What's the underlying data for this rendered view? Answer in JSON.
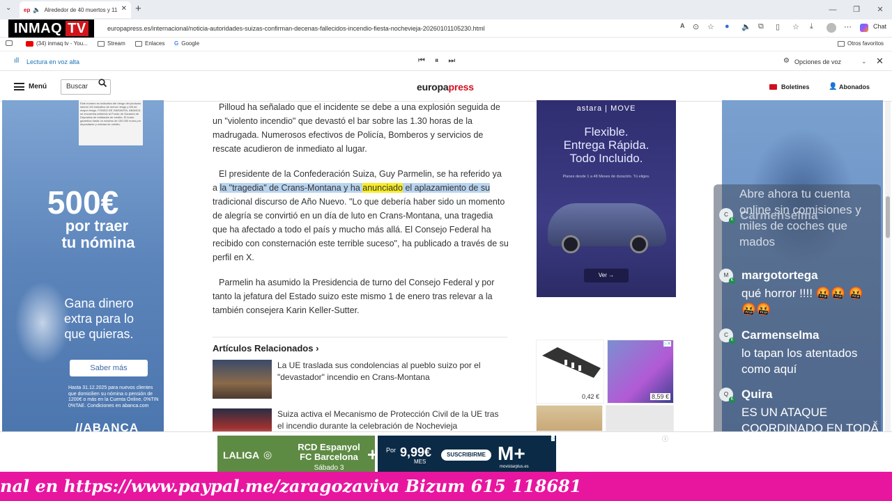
{
  "browser": {
    "tab_title": "Alrededor de 40 muertos y 11",
    "tab_favicon": "ep",
    "url": "europapress.es/internacional/noticia-autoridades-suizas-confirman-decenas-fallecidos-incendio-fiesta-nochevieja-20260101105230.html",
    "chat_label": "Chat",
    "bookmarks": [
      "(34) inmaq tv - You...",
      "Stream",
      "Enlaces",
      "Google"
    ],
    "other_favorites": "Otros favoritos"
  },
  "read_aloud": {
    "label": "Lectura en voz alta",
    "voice_options": "Opciones de voz"
  },
  "site": {
    "menu": "Menú",
    "search": "Buscar",
    "logo_a": "europa",
    "logo_b": "press",
    "newsletters": "Boletines",
    "subscribers": "Abonados"
  },
  "article": {
    "p1": "Pilloud ha señalado que el incidente se debe a una explosión seguida de un \"violento incendio\" que devastó el bar sobre las 1.30 horas de la madrugada. Numerosos efectivos de Policía, Bomberos y servicios de rescate acudieron de inmediato al lugar.",
    "p2_a": "El presidente de la Confederación Suiza, Guy Parmelin, se ha referido ya a ",
    "p2_hl1": "la \"tragedia\" de Crans-Montana y ha ",
    "p2_hl2": "anunciado",
    "p2_hl3": " el aplazamiento de su",
    "p2_b": " tradicional discurso de Año Nuevo. \"Lo que debería haber sido un momento de alegría se convirtió en un día de luto en Crans-Montana, una tragedia que ha afectado a todo el país y mucho más allá. El Consejo Federal ha recibido con consternación este terrible suceso\", ha publicado a través de su perfil en X.",
    "p3": "Parmelin ha asumido la Presidencia de turno del Consejo Federal y por tanto la jefatura del Estado suizo este mismo 1 de enero tras relevar a la también consejera Karin Keller-Sutter.",
    "related_title": "Artículos Relacionados",
    "related": [
      "La UE traslada sus condolencias al pueblo suizo por el \"devastador\" incendio en Crans-Montana",
      "Suiza activa el Mecanismo de Protección Civil de la UE tras el incendio durante la celebración de Nochevieja"
    ]
  },
  "left_ad": {
    "small_print": "Este número es indicativo del riesgo del producto siendo 1/6 indicativo de menor riesgo y 6/6 de mayor riesgo. FONDO DE GARANTÍA. ABANCA se encuentra adherido al Fondo de Garantía de Depósitos de entidades de crédito. El fondo garantiza hasta un máximo de 100.000 euros por depositante y entidad de crédito.",
    "amount": "500€",
    "line1": "por traer",
    "line2": "tu nómina",
    "line3": "Gana dinero",
    "line4": "extra para lo",
    "line5": "que quieras.",
    "button": "Saber más",
    "fine": "Hasta 31.12.2025 para nuevos clientes que domicilien su nómina o pensión de 1200€ o más en la Cuenta Online. 0%TIN 0%TAE. Condiciones en abanca.com",
    "brand": "//ABANCA"
  },
  "astara_ad": {
    "brand": "astara | MOVE",
    "line1": "Flexible.",
    "line2": "Entrega Rápida.",
    "line3": "Todo Incluido.",
    "sub": "Planes desde 1 a 48 Meses de duración. Tú eliges.",
    "cta": "Ver"
  },
  "products": [
    {
      "price": "0,42 €"
    },
    {
      "price": "8,59 €"
    }
  ],
  "chat": {
    "overlay_top": "Abre ahora tu cuenta online sin comisiones y miles de coches que mados",
    "messages": [
      {
        "initial": "C",
        "name": "Carmenselma",
        "text": ""
      },
      {
        "initial": "M",
        "name": "margotortega",
        "text": "qué horror !!!! 🤬🤬 🤬🤬🤬"
      },
      {
        "initial": "C",
        "name": "Carmenselma",
        "text": "lo tapan los atentados como aquí"
      },
      {
        "initial": "Q",
        "name": "Quira",
        "text": "ES UN ATAQUE COORDINADO EN TODA EUROPA"
      }
    ]
  },
  "bottom_ad": {
    "league": "LALIGA",
    "match1": "RCD Espanyol",
    "match2": "FC Barcelona",
    "match_day": "Sábado 3",
    "price_prefix": "Por",
    "price": "9,99€",
    "price_unit": "MES",
    "cta": "SUSCRIBIRME",
    "movistar_url": "movistarplus.es"
  },
  "stream": {
    "logo_a": "INMAQ",
    "logo_b": "TV",
    "ticker": "nal en https://www.paypal.me/zaragozaviva Bizum 615 118681"
  }
}
